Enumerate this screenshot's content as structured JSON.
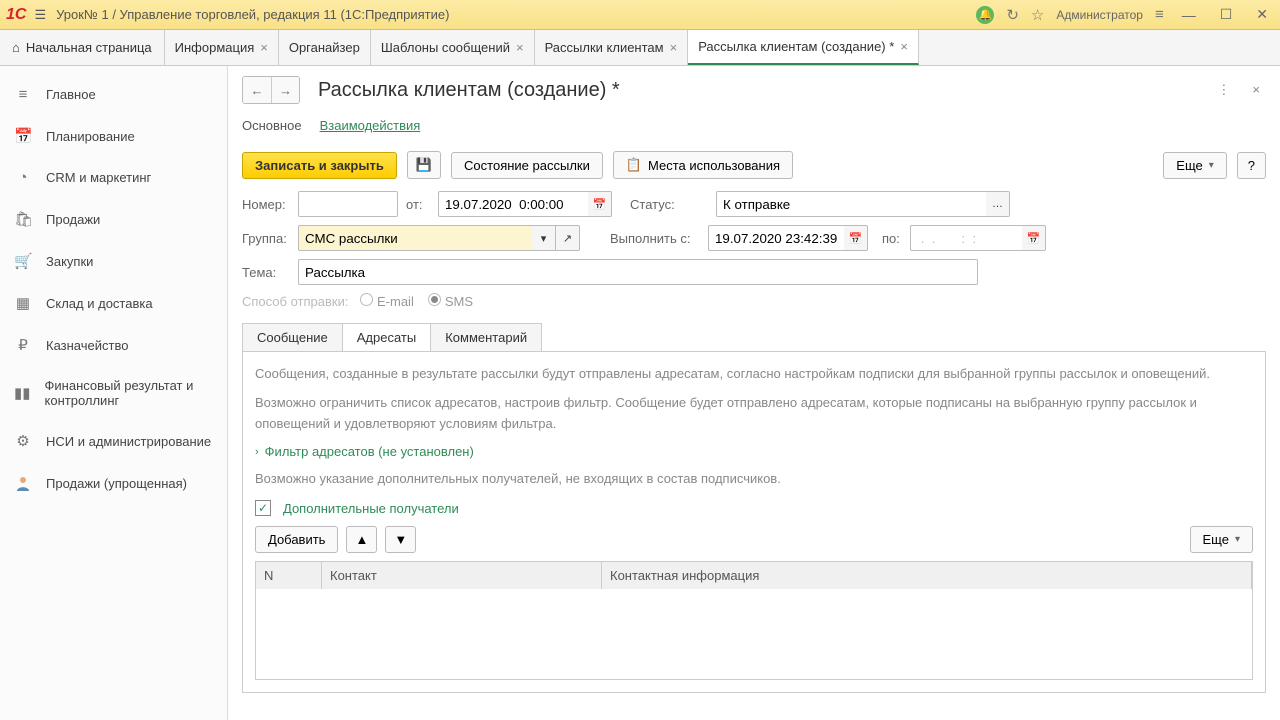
{
  "titlebar": {
    "logo": "1C",
    "title": "Урок№ 1 / Управление торговлей, редакция 11  (1С:Предприятие)",
    "user": "Администратор"
  },
  "tabs": {
    "home": "Начальная страница",
    "items": [
      {
        "label": "Информация"
      },
      {
        "label": "Органайзер"
      },
      {
        "label": "Шаблоны сообщений"
      },
      {
        "label": "Рассылки клиентам"
      },
      {
        "label": "Рассылка клиентам (создание) *"
      }
    ]
  },
  "sidebar": {
    "items": [
      {
        "icon": "≡",
        "label": "Главное"
      },
      {
        "icon": "📅",
        "label": "Планирование"
      },
      {
        "icon": "◔",
        "label": "CRM и маркетинг"
      },
      {
        "icon": "🛍",
        "label": "Продажи"
      },
      {
        "icon": "🛒",
        "label": "Закупки"
      },
      {
        "icon": "▦",
        "label": "Склад и доставка"
      },
      {
        "icon": "₽",
        "label": "Казначейство"
      },
      {
        "icon": "▮▮",
        "label": "Финансовый результат и контроллинг"
      },
      {
        "icon": "⚙",
        "label": "НСИ и администрирование"
      },
      {
        "icon": "👤",
        "label": "Продажи (упрощенная)"
      }
    ]
  },
  "page": {
    "title": "Рассылка клиентам (создание) *",
    "subtabs": {
      "main": "Основное",
      "interact": "Взаимодействия"
    }
  },
  "toolbar": {
    "save_close": "Записать и закрыть",
    "status_btn": "Состояние рассылки",
    "usage_btn": "Места использования",
    "more": "Еще",
    "help": "?"
  },
  "form": {
    "number_label": "Номер:",
    "number": "",
    "from_label": "от:",
    "from_date": "19.07.2020  0:00:00",
    "status_label": "Статус:",
    "status": "К отправке",
    "group_label": "Группа:",
    "group": "СМС рассылки",
    "runfrom_label": "Выполнить с:",
    "runfrom": "19.07.2020 23:42:39",
    "to_label": "по:",
    "to": " .  .       :  :",
    "subject_label": "Тема:",
    "subject": "Рассылка",
    "method_label": "Способ отправки:",
    "method_email": "E-mail",
    "method_sms": "SMS"
  },
  "inner_tabs": {
    "msg": "Сообщение",
    "recipients": "Адресаты",
    "comment": "Комментарий"
  },
  "panel": {
    "info1": "Сообщения, созданные в результате рассылки будут отправлены адресатам, согласно настройкам подписки для выбранной группы рассылок и оповещений.",
    "info2": "Возможно ограничить список адресатов, настроив фильтр. Сообщение будет отправлено адресатам, которые подписаны на выбранную группу рассылок и оповещений и удовлетворяют условиям фильтра.",
    "filter": "Фильтр адресатов (не установлен)",
    "info3": "Возможно указание дополнительных получателей, не входящих в состав подписчиков.",
    "extra": "Дополнительные получатели",
    "add": "Добавить",
    "grid": {
      "n": "N",
      "contact": "Контакт",
      "info": "Контактная информация"
    }
  }
}
